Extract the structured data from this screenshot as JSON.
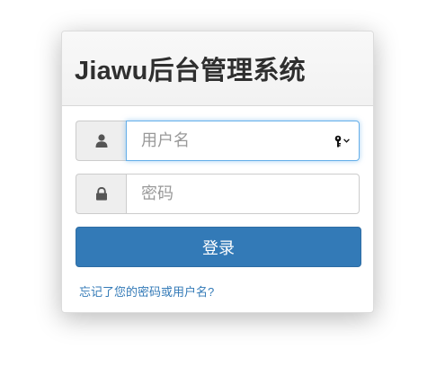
{
  "header": {
    "title": "Jiawu后台管理系统"
  },
  "login_form": {
    "username": {
      "icon": "user-icon",
      "placeholder": "用户名",
      "value": ""
    },
    "password": {
      "icon": "lock-icon",
      "placeholder": "密码",
      "value": ""
    },
    "submit_label": "登录",
    "forgot_link": "忘记了您的密码或用户名?"
  },
  "colors": {
    "primary": "#337ab7",
    "link": "#337ab7",
    "focus_border": "#66afe9",
    "addon_bg": "#eeeeee"
  }
}
